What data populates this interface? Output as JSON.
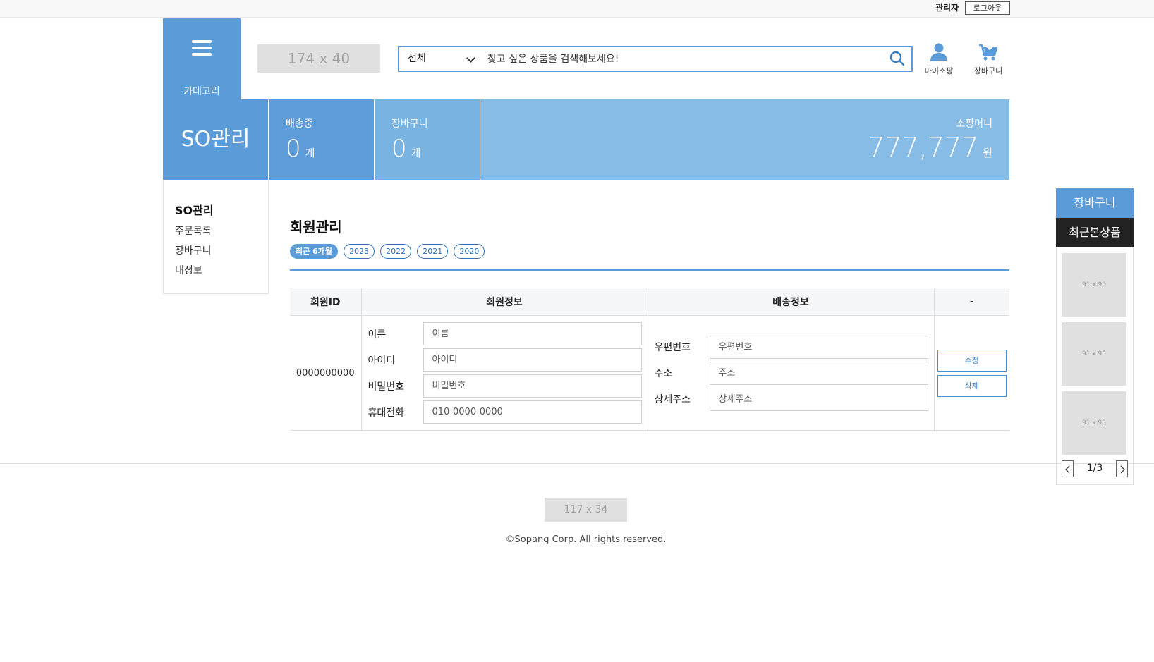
{
  "topbar": {
    "admin_label": "관리자",
    "logout_label": "로그아웃"
  },
  "header": {
    "category_label": "카테고리",
    "logo_placeholder": "174 x 40",
    "search": {
      "selected_category": "전체",
      "placeholder": "찾고 싶은 상품을 검색해보세요!"
    },
    "mypage_label": "마이소팡",
    "cart_label": "장바구니"
  },
  "summary": {
    "title": "SO관리",
    "shipping": {
      "caption": "배송중",
      "count": "0",
      "unit": "개"
    },
    "cart": {
      "caption": "장바구니",
      "count": "0",
      "unit": "개"
    },
    "money": {
      "caption": "소팡머니",
      "amount": "777,777",
      "unit": "원"
    }
  },
  "sidenav": {
    "heading": "SO관리",
    "items": [
      {
        "label": "주문목록"
      },
      {
        "label": "장바구니"
      },
      {
        "label": "내정보"
      }
    ]
  },
  "content": {
    "title": "회원관리",
    "periods": [
      {
        "label": "최근 6개월",
        "active": true
      },
      {
        "label": "2023"
      },
      {
        "label": "2022"
      },
      {
        "label": "2021"
      },
      {
        "label": "2020"
      }
    ],
    "table": {
      "headers": [
        "회원ID",
        "회원정보",
        "배송정보",
        "-"
      ],
      "row": {
        "member_id": "0000000000",
        "info_fields": [
          {
            "label": "이름",
            "placeholder": "이름"
          },
          {
            "label": "아이디",
            "placeholder": "아이디"
          },
          {
            "label": "비밀번호",
            "placeholder": "비밀번호"
          },
          {
            "label": "휴대전화",
            "placeholder": "010-0000-0000"
          }
        ],
        "ship_fields": [
          {
            "label": "우편번호",
            "placeholder": "우편번호"
          },
          {
            "label": "주소",
            "placeholder": "주소"
          },
          {
            "label": "상세주소",
            "placeholder": "상세주소"
          }
        ],
        "edit_label": "수정",
        "delete_label": "삭제"
      }
    }
  },
  "footer": {
    "logo_placeholder": "117 x 34",
    "copyright": "©Sopang Corp. All rights reserved."
  },
  "quick_panel": {
    "cart_label": "장바구니",
    "recent_label": "최근본상품",
    "thumbs": [
      {
        "label": "91 x 90"
      },
      {
        "label": "91 x 90"
      },
      {
        "label": "91 x 90"
      }
    ],
    "page": "1/3"
  },
  "colors": {
    "primary": "#5a9bd8",
    "light": "#86bce5",
    "mid": "#79b3e2",
    "dark": "#222222"
  }
}
